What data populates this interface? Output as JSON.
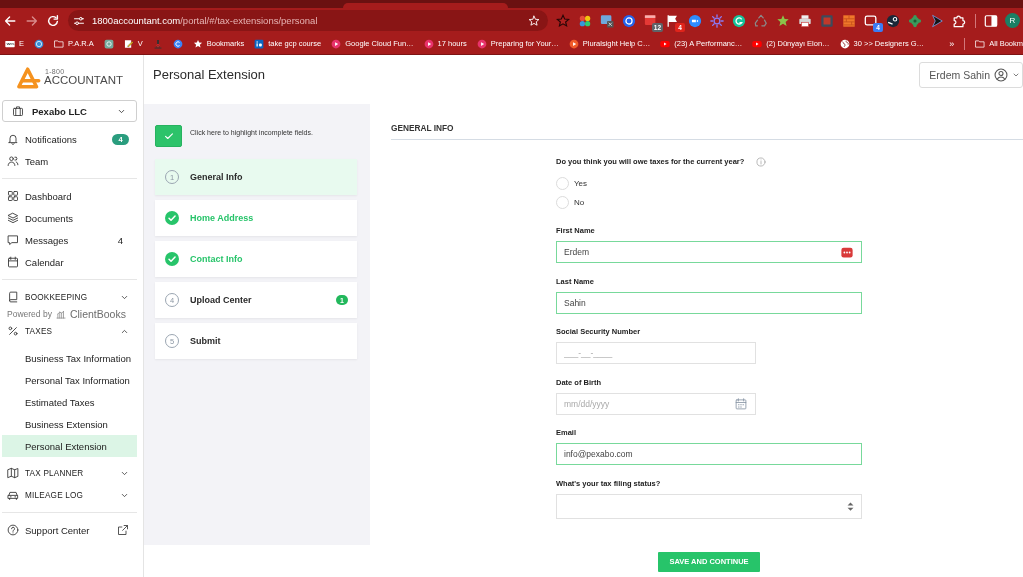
{
  "browser": {
    "nav": [
      {
        "kind": "back",
        "disabled": false
      },
      {
        "kind": "forward",
        "disabled": true
      },
      {
        "kind": "reload",
        "disabled": false
      }
    ],
    "address": {
      "host": "1800accountant.com",
      "path": "/portal/#/tax-extensions/personal"
    },
    "extensions": [
      {
        "kind": "star"
      },
      {
        "kind": "pinwheel"
      },
      {
        "kind": "window"
      },
      {
        "kind": "target"
      },
      {
        "kind": "tile",
        "badge": "12"
      },
      {
        "kind": "flag",
        "badge": "4"
      },
      {
        "kind": "meeting"
      },
      {
        "kind": "sun"
      },
      {
        "kind": "grammar"
      },
      {
        "kind": "recycle"
      },
      {
        "kind": "leaf"
      },
      {
        "kind": "printer"
      },
      {
        "kind": "screen"
      },
      {
        "kind": "stripes"
      },
      {
        "kind": "tabs",
        "badge": "4"
      },
      {
        "kind": "steam"
      },
      {
        "kind": "gear"
      },
      {
        "kind": "pointer"
      },
      {
        "kind": "puzzle"
      }
    ],
    "profile": "R",
    "bookmarks": [
      {
        "kind": "wix",
        "label": "E"
      },
      {
        "kind": "wordpress"
      },
      {
        "kind": "folder",
        "label": "P.A.R.A"
      },
      {
        "kind": "openai"
      },
      {
        "kind": "pencil",
        "label": "V"
      },
      {
        "kind": "microscope"
      },
      {
        "kind": "coin"
      },
      {
        "kind": "star",
        "label": "Bookmarks"
      },
      {
        "kind": "linkedin",
        "label": "take gcp course"
      },
      {
        "kind": "podcast",
        "label": "Google Cloud Fun…"
      },
      {
        "kind": "podcast",
        "label": "17 hours"
      },
      {
        "kind": "podcast",
        "label": "Preparing for Your…"
      },
      {
        "kind": "pluralsight",
        "label": "Pluralsight Help C…"
      },
      {
        "kind": "youtube",
        "label": "(23) A Performanc…"
      },
      {
        "kind": "youtube",
        "label": "(2) Dünyayı Elon…"
      },
      {
        "kind": "globe",
        "label": "30 >> Designers G…"
      }
    ],
    "overflow": "»",
    "all_bookmarks": "All Bookm"
  },
  "sidebar": {
    "logo": {
      "prefix": "1-800",
      "name": "ACCOUNTANT"
    },
    "company": "Pexabo LLC",
    "sections": [
      {
        "items": [
          {
            "kind": "bell",
            "label": "Notifications",
            "badge": "4",
            "selected": false
          },
          {
            "kind": "team",
            "label": "Team",
            "selected": false
          }
        ]
      },
      {
        "items": [
          {
            "kind": "grid",
            "label": "Dashboard",
            "selected": false
          },
          {
            "kind": "layers",
            "label": "Documents",
            "selected": false
          },
          {
            "kind": "chat",
            "label": "Messages",
            "count": "4",
            "selected": false
          },
          {
            "kind": "calendar",
            "label": "Calendar",
            "selected": false
          }
        ]
      },
      {
        "items": [
          {
            "kind": "book",
            "label": "BOOKKEEPING",
            "expanded": false,
            "selected": false,
            "powered_by": {
              "prefix": "Powered by",
              "brand": "ClientBooks"
            }
          },
          {
            "kind": "percent",
            "label": "TAXES",
            "expanded": true,
            "selected": false,
            "children": [
              {
                "label": "Business Tax Information",
                "selected": false
              },
              {
                "label": "Personal Tax Information",
                "selected": false
              },
              {
                "label": "Estimated Taxes",
                "selected": false
              },
              {
                "label": "Business Extension",
                "selected": false
              },
              {
                "label": "Personal Extension",
                "selected": true
              }
            ]
          },
          {
            "kind": "map",
            "label": "TAX PLANNER",
            "expanded": false,
            "selected": false
          },
          {
            "kind": "car",
            "label": "MILEAGE LOG",
            "expanded": false,
            "selected": false
          }
        ]
      },
      {
        "items": [
          {
            "kind": "help",
            "label": "Support Center",
            "external": true,
            "selected": false
          }
        ]
      }
    ]
  },
  "header": {
    "title": "Personal Extension",
    "user": "Erdem Sahin"
  },
  "steps_panel": {
    "highlight": {
      "checked": true,
      "label": "Click here to highlight incomplete fields."
    },
    "steps": [
      {
        "number": "1",
        "label": "General Info",
        "done": false,
        "selected": true
      },
      {
        "label": "Home Address",
        "done": true,
        "selected": false
      },
      {
        "label": "Contact Info",
        "done": true,
        "selected": false
      },
      {
        "number": "4",
        "label": "Upload Center",
        "done": false,
        "badge": "1",
        "selected": false
      },
      {
        "number": "5",
        "label": "Submit",
        "done": false,
        "selected": false
      }
    ]
  },
  "form": {
    "section_title": "GENERAL INFO",
    "question": {
      "label": "Do you think you will owe taxes for the current year?",
      "info": true,
      "options": [
        {
          "label": "Yes",
          "selected": false
        },
        {
          "label": "No",
          "selected": false
        }
      ]
    },
    "fields": [
      {
        "label": "First Name",
        "kind": "text",
        "value": "Erdem",
        "complete": true,
        "autofill": true
      },
      {
        "label": "Last Name",
        "kind": "text",
        "value": "Sahin",
        "complete": true
      },
      {
        "label": "Social Security Number",
        "kind": "masked",
        "placeholder": "___-__-____",
        "complete": false
      },
      {
        "label": "Date of Birth",
        "kind": "date",
        "placeholder": "mm/dd/yyyy",
        "complete": false
      },
      {
        "label": "Email",
        "kind": "text",
        "value": "info@pexabo.com",
        "complete": true
      },
      {
        "label": "What's your tax filing status?",
        "kind": "select",
        "complete": false
      }
    ],
    "submit": "SAVE AND CONTINUE"
  }
}
